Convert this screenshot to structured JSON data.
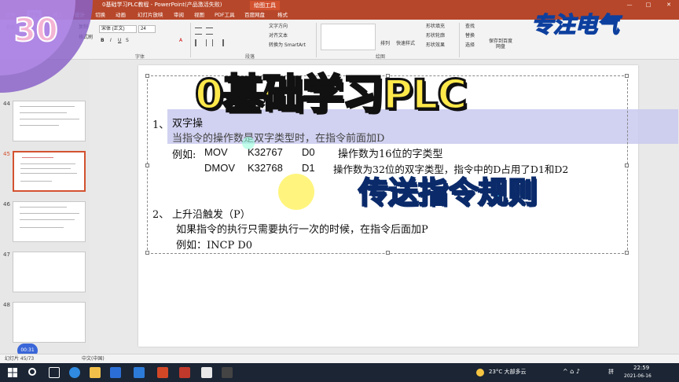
{
  "window": {
    "title": "0基础学习PLC教程 - PowerPoint(产品激活失败)",
    "context_tab": "绘图工具",
    "controls": [
      "—",
      "□",
      "✕"
    ]
  },
  "ribbon": {
    "tabs": [
      "文件",
      "开始",
      "插入",
      "设计",
      "切换",
      "动画",
      "幻灯片放映",
      "审阅",
      "视图",
      "PDF工具",
      "百度网盘",
      "格式"
    ],
    "active_tab": "开始",
    "font_name": "宋体 (正文)",
    "font_size": "24",
    "groups": [
      "字体",
      "段落",
      "绘图"
    ],
    "commands": [
      "文字方向",
      "对齐文本",
      "转换为 SmartArt",
      "排列",
      "快速样式",
      "形状填充",
      "形状轮廓",
      "形状效果",
      "查找",
      "替换",
      "选择",
      "保存到百度网盘"
    ],
    "left_commands": [
      "粘贴",
      "复制",
      "格式刷"
    ]
  },
  "thumbnails": [
    {
      "num": "44"
    },
    {
      "num": "45",
      "selected": true
    },
    {
      "num": "46"
    },
    {
      "num": "47"
    },
    {
      "num": "48"
    }
  ],
  "slide": {
    "item1_num": "1、",
    "item1_title": "双字操",
    "item1_line1": "当指令的操作数是双字类型时，在指令前面加D",
    "example_label": "例如:",
    "ex1_op": "MOV",
    "ex1_a": "K32767",
    "ex1_b": "D0",
    "ex1_desc": "操作数为16位的字类型",
    "ex2_op": "DMOV",
    "ex2_a": "K32768",
    "ex2_b": "D1",
    "ex2_desc": "操作数为32位的双字类型，指令中的D占用了D1和D2",
    "item2_num": "2、",
    "item2_title": "上升沿触发（P）",
    "item2_line1": "如果指令的执行只需要执行一次的时候，在指令后面加P",
    "item2_example": "例如：INCP  D0"
  },
  "overlay": {
    "episode": "30",
    "title": "0基础学习PLC",
    "subtitle": "传送指令规则",
    "brand": "专注电气",
    "timer": "00:31"
  },
  "status": {
    "slide_info": "幻灯片 45/73",
    "lang": "中文(中国)"
  },
  "taskbar": {
    "weather": "23°C 大部多云",
    "time": "22:59",
    "date": "2021-06-16",
    "ime": "拼"
  },
  "colors": {
    "accent": "#b7472a",
    "highlight": "#c9c9ee",
    "title_fill": "#ffe94a",
    "subtitle_fill": "#3fd9f2"
  }
}
